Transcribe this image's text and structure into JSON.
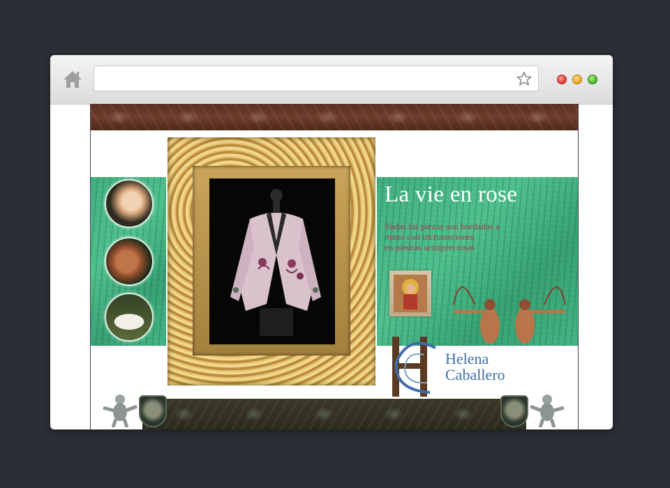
{
  "browser": {
    "address_value": "",
    "controls": [
      "home-icon",
      "star-icon",
      "close-dot",
      "minimize-dot",
      "maximize-dot"
    ]
  },
  "page": {
    "headline": "La vie en rose",
    "subtitle_lines": [
      "Todas las piezas son bordadas a",
      "mano con incrustaciones",
      "en piedras semipreciosas"
    ],
    "brand": {
      "line1": "Helena",
      "line2": "Caballero"
    }
  },
  "colors": {
    "background": "#2b2e35",
    "green_band": "#44b383",
    "headline": "#ffffff",
    "subtitle": "#a33a4e",
    "brand": "#3e6ea8",
    "gold_frame": "#c9a45b",
    "top_banner": "#5a3022"
  }
}
